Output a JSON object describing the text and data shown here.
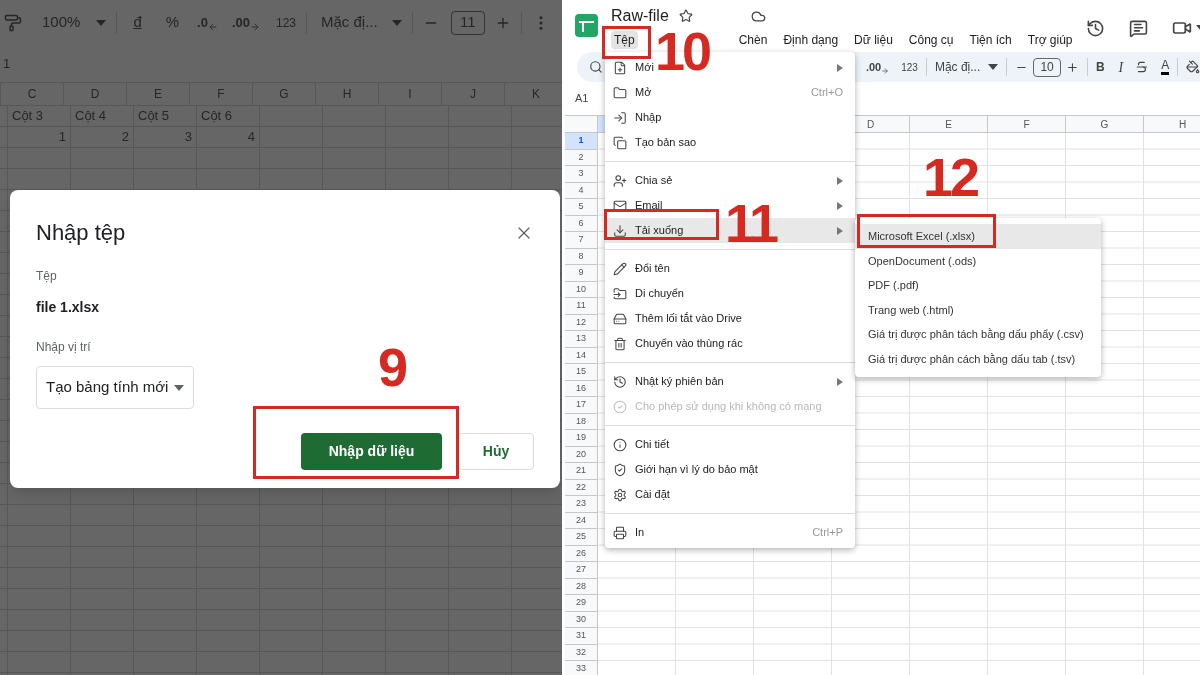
{
  "left_sheet": {
    "toolbar": {
      "zoom": "100%",
      "currency": "đ",
      "percent": "%",
      "decrease_decimals": ".0",
      "increase_decimals": ".00",
      "number_format": "123",
      "font": "Mặc đị...",
      "font_size": "11"
    },
    "formula_value": "1",
    "columns": [
      "C",
      "D",
      "E",
      "F",
      "G",
      "H",
      "I",
      "J",
      "K"
    ],
    "rows": [
      [
        "Cột 3",
        "Cột 4",
        "Cột 5",
        "Cột 6"
      ],
      [
        "1",
        "2",
        "3",
        "4"
      ]
    ]
  },
  "dialog": {
    "title": "Nhập tệp",
    "file_label": "Tệp",
    "file_name": "file 1.xlsx",
    "location_label": "Nhập vị trí",
    "location": "Tạo bảng tính mới",
    "buttons": [
      {
        "label": "Nhập dữ liệu",
        "kind": "primary"
      },
      {
        "label": "Hủy",
        "kind": "secondary"
      }
    ]
  },
  "right_sheet": {
    "title": "Raw-file",
    "menus": [
      {
        "label": "Tệp",
        "selected": true
      },
      {
        "label": "Chèn",
        "selected": false
      },
      {
        "label": "Định dạng",
        "selected": false
      },
      {
        "label": "Dữ liệu",
        "selected": false
      },
      {
        "label": "Công cụ",
        "selected": false
      },
      {
        "label": "Tiện ích",
        "selected": false
      },
      {
        "label": "Trợ giúp",
        "selected": false
      }
    ],
    "toolbar": {
      "increase_decimals": ".00",
      "number_format": "123",
      "font": "Mặc đị...",
      "font_size": "10",
      "bold": "B",
      "italic": "I",
      "text_color": "A"
    },
    "name_box": "A1",
    "columns": [
      "D",
      "E",
      "F",
      "G",
      "H"
    ],
    "row_numbers": [
      {
        "label": "1",
        "selected": true
      },
      {
        "label": "2",
        "selected": false
      },
      {
        "label": "3",
        "selected": false
      },
      {
        "label": "4",
        "selected": false
      },
      {
        "label": "5",
        "selected": false
      },
      {
        "label": "6",
        "selected": false
      },
      {
        "label": "7",
        "selected": false
      },
      {
        "label": "8",
        "selected": false
      },
      {
        "label": "9",
        "selected": false
      },
      {
        "label": "10",
        "selected": false
      },
      {
        "label": "11",
        "selected": false
      },
      {
        "label": "12",
        "selected": false
      },
      {
        "label": "13",
        "selected": false
      },
      {
        "label": "14",
        "selected": false
      },
      {
        "label": "15",
        "selected": false
      },
      {
        "label": "16",
        "selected": false
      },
      {
        "label": "17",
        "selected": false
      },
      {
        "label": "18",
        "selected": false
      },
      {
        "label": "19",
        "selected": false
      },
      {
        "label": "20",
        "selected": false
      },
      {
        "label": "21",
        "selected": false
      },
      {
        "label": "22",
        "selected": false
      },
      {
        "label": "23",
        "selected": false
      },
      {
        "label": "24",
        "selected": false
      },
      {
        "label": "25",
        "selected": false
      },
      {
        "label": "26",
        "selected": false
      },
      {
        "label": "27",
        "selected": false
      },
      {
        "label": "28",
        "selected": false
      },
      {
        "label": "29",
        "selected": false
      },
      {
        "label": "30",
        "selected": false
      },
      {
        "label": "31",
        "selected": false
      },
      {
        "label": "32",
        "selected": false
      },
      {
        "label": "33",
        "selected": false
      }
    ]
  },
  "file_menu": {
    "groups": [
      [
        {
          "label": "Mới",
          "submenu": true,
          "selected": false,
          "disabled": false
        },
        {
          "label": "Mở",
          "shortcut": "Ctrl+O",
          "selected": false,
          "disabled": false
        },
        {
          "label": "Nhập",
          "selected": false,
          "disabled": false
        },
        {
          "label": "Tạo bản sao",
          "selected": false,
          "disabled": false
        }
      ],
      [
        {
          "label": "Chia sẻ",
          "submenu": true,
          "selected": false,
          "disabled": false
        },
        {
          "label": "Email",
          "submenu": true,
          "selected": false,
          "disabled": false
        },
        {
          "label": "Tải xuống",
          "submenu": true,
          "selected": true,
          "disabled": false
        }
      ],
      [
        {
          "label": "Đổi tên",
          "selected": false,
          "disabled": false
        },
        {
          "label": "Di chuyển",
          "selected": false,
          "disabled": false
        },
        {
          "label": "Thêm lối tắt vào Drive",
          "selected": false,
          "disabled": false
        },
        {
          "label": "Chuyển vào thùng rác",
          "selected": false,
          "disabled": false
        }
      ],
      [
        {
          "label": "Nhật ký phiên bản",
          "submenu": true,
          "selected": false,
          "disabled": false
        },
        {
          "label": "Cho phép sử dụng khi không có mạng",
          "selected": false,
          "disabled": true
        }
      ],
      [
        {
          "label": "Chi tiết",
          "selected": false,
          "disabled": false
        },
        {
          "label": "Giới hạn vì lý do bảo mật",
          "selected": false,
          "disabled": false
        },
        {
          "label": "Cài đặt",
          "selected": false,
          "disabled": false
        }
      ],
      [
        {
          "label": "In",
          "shortcut": "Ctrl+P",
          "selected": false,
          "disabled": false
        }
      ]
    ]
  },
  "download_submenu": {
    "items": [
      {
        "label": "Microsoft Excel (.xlsx)",
        "selected": true
      },
      {
        "label": "OpenDocument (.ods)",
        "selected": false
      },
      {
        "label": "PDF (.pdf)",
        "selected": false
      },
      {
        "label": "Trang web (.html)",
        "selected": false
      },
      {
        "label": "Giá trị được phân tách bằng dấu phẩy (.csv)",
        "selected": false
      },
      {
        "label": "Giá trị được phân cách bằng dấu tab (.tsv)",
        "selected": false
      }
    ]
  },
  "annotations": [
    {
      "label": "9"
    },
    {
      "label": "10"
    },
    {
      "label": "11"
    },
    {
      "label": "12"
    }
  ]
}
